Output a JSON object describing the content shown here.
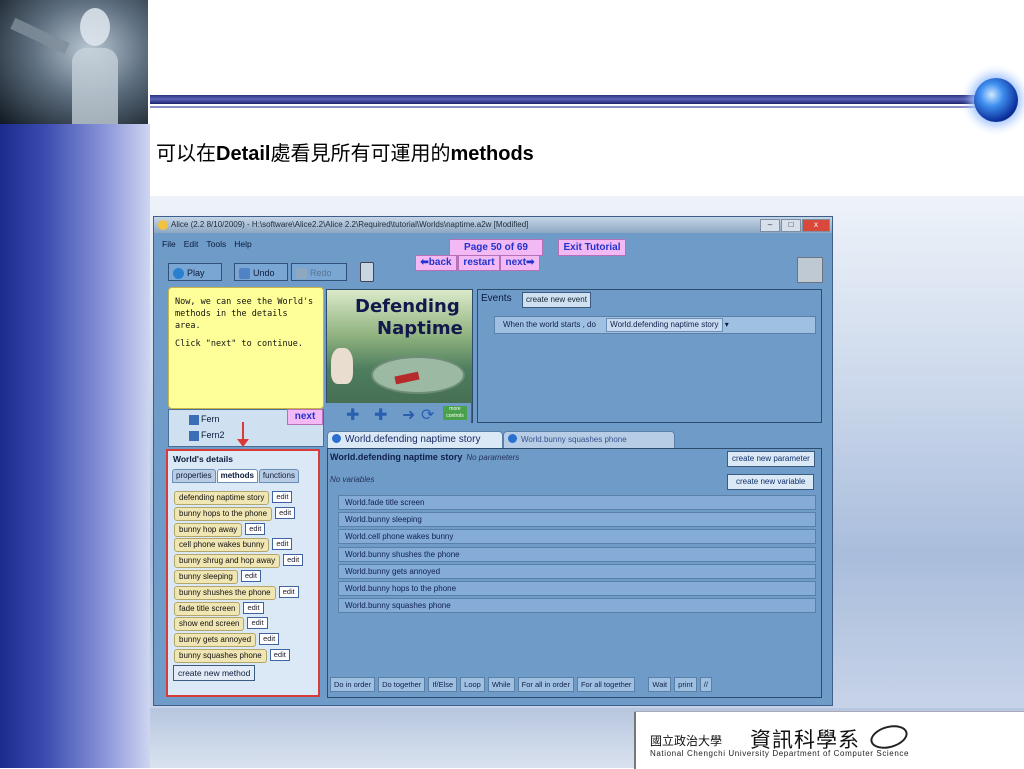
{
  "slide": {
    "title_prefix": "可以在",
    "title_bold1": "Detail",
    "title_middle": "處看見所有可運用的",
    "title_bold2": "methods"
  },
  "footer": {
    "university_small": "國立政治大學",
    "department_big": "資訊科學系",
    "english": "National Chengchi University Department of Computer Science"
  },
  "window": {
    "title": "Alice (2.2 8/10/2009) - H:\\software\\Alice2.2\\Alice 2.2\\Required\\tutorial\\Worlds\\naptime.a2w [Modified]",
    "controls": [
      "–",
      "□",
      "x"
    ],
    "menu": [
      "File",
      "Edit",
      "Tools",
      "Help"
    ],
    "toolbar": {
      "play": "Play",
      "undo": "Undo",
      "redo": "Redo"
    }
  },
  "tutorial": {
    "page": "Page 50 of 69",
    "exit": "Exit Tutorial",
    "back": "back",
    "restart": "restart",
    "next": "next",
    "note_line1": "Now, we can see the World's methods in the details area.",
    "note_line2": "Click \"next\" to continue.",
    "next_label": "next"
  },
  "scene": {
    "title_line1": "Defending",
    "title_line2": "Naptime",
    "more_controls": "more controls"
  },
  "object_tree": {
    "items": [
      "Fern",
      "Fern2"
    ]
  },
  "events": {
    "heading": "Events",
    "create_button": "create new event",
    "event_trigger": "When the world starts , do",
    "event_action": "World.defending naptime story"
  },
  "details": {
    "heading": "World's details",
    "tabs": [
      "properties",
      "methods",
      "functions"
    ],
    "edit_label": "edit",
    "methods": [
      "defending naptime story",
      "bunny hops to the phone",
      "bunny hop away",
      "cell phone wakes bunny",
      "bunny shrug and hop away",
      "bunny sleeping",
      "bunny shushes the phone",
      "fade title screen",
      "show end screen",
      "bunny gets annoyed",
      "bunny squashes phone"
    ],
    "create_method": "create new method"
  },
  "editor": {
    "tabs": [
      "World.defending naptime story",
      "World.bunny squashes phone"
    ],
    "signature": "World.defending naptime story",
    "no_parameters": "No parameters",
    "no_variables": "No variables",
    "create_parameter": "create new parameter",
    "create_variable": "create new variable",
    "statements": [
      "World.fade title screen",
      "World.bunny sleeping",
      "World.cell phone wakes bunny",
      "World.bunny shushes the phone",
      "World.bunny gets annoyed",
      "World.bunny hops to the phone",
      "World.bunny squashes phone"
    ],
    "control_bar": [
      "Do in order",
      "Do together",
      "If/Else",
      "Loop",
      "While",
      "For all in order",
      "For all together",
      "Wait",
      "print",
      "//"
    ]
  },
  "colors": {
    "highlight_box": "#d93a3a",
    "tutorial_pink": "#f2b9f4",
    "note_yellow": "#ffff99",
    "alice_blue": "#6f9bc9"
  }
}
